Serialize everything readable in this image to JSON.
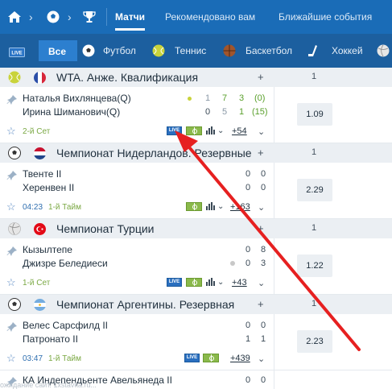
{
  "topbar": {
    "tabs": [
      {
        "label": "Матчи",
        "active": true
      },
      {
        "label": "Рекомендовано вам",
        "active": false
      },
      {
        "label": "Ближайшие события",
        "active": false
      }
    ]
  },
  "sport_tabs": {
    "live_label": "LIVE",
    "all_label": "Все",
    "items": [
      {
        "label": "Футбол",
        "icon": "soccer-ball-icon"
      },
      {
        "label": "Теннис",
        "icon": "tennis-ball-icon"
      },
      {
        "label": "Баскетбол",
        "icon": "basketball-icon"
      },
      {
        "label": "Хоккей",
        "icon": "hockey-stick-icon"
      }
    ]
  },
  "leagues": [
    {
      "name": "WTA. Анже. Квалификация",
      "sport_icon": "tennis-ball-icon",
      "flag": "france-flag-icon",
      "plus": "+",
      "one": "1",
      "matches": [
        {
          "team1": "Наталья Вихлянцева(Q)",
          "team2": "Ирина Шиманович(Q)",
          "serve_dot": true,
          "score1": [
            "1",
            "7",
            "3",
            "(0)"
          ],
          "score2": [
            "0",
            "5",
            "1",
            "(15)"
          ],
          "status": "2-й Сет",
          "time": "",
          "live": "LIVE",
          "more": "+54",
          "odds": "1.09"
        }
      ]
    },
    {
      "name": "Чемпионат Нидерландов. Резервные",
      "sport_icon": "soccer-ball-icon",
      "flag": "netherlands-flag-icon",
      "plus": "+",
      "one": "1",
      "matches": [
        {
          "team1": "Твенте II",
          "team2": "Херенвен II",
          "score1": [
            "0",
            "0"
          ],
          "score2": [
            "0",
            "0"
          ],
          "status": "1-й Тайм",
          "time": "04:23",
          "more": "+163",
          "odds": "2.29"
        }
      ]
    },
    {
      "name": "Чемпионат Турции",
      "sport_icon": "volleyball-icon",
      "flag": "turkey-flag-icon",
      "plus": "+",
      "one": "1",
      "matches": [
        {
          "team1": "Кызылтепе",
          "team2": "Джизре Беледиеси",
          "serve_dot": true,
          "score1": [
            "0",
            "8"
          ],
          "score2": [
            "0",
            "3"
          ],
          "status": "1-й Сет",
          "time": "",
          "live": "LIVE",
          "more": "+43",
          "odds": "1.22"
        }
      ]
    },
    {
      "name": "Чемпионат Аргентины. Резервная",
      "sport_icon": "soccer-ball-icon",
      "flag": "argentina-flag-icon",
      "plus": "+",
      "one": "1",
      "matches": [
        {
          "team1": "Велес Сарсфилд II",
          "team2": "Патронато II",
          "score1": [
            "0",
            "0"
          ],
          "score2": [
            "1",
            "1"
          ],
          "status": "1-й Тайм",
          "time": "03:47",
          "live": "LIVE",
          "more": "+439",
          "odds": "2.23"
        },
        {
          "team1": "КА Индепендьенте Авельянеда II",
          "score1": [
            "0",
            "0"
          ]
        }
      ]
    }
  ],
  "footer_text": "ожидание сайт. 1xstavka.ru..."
}
